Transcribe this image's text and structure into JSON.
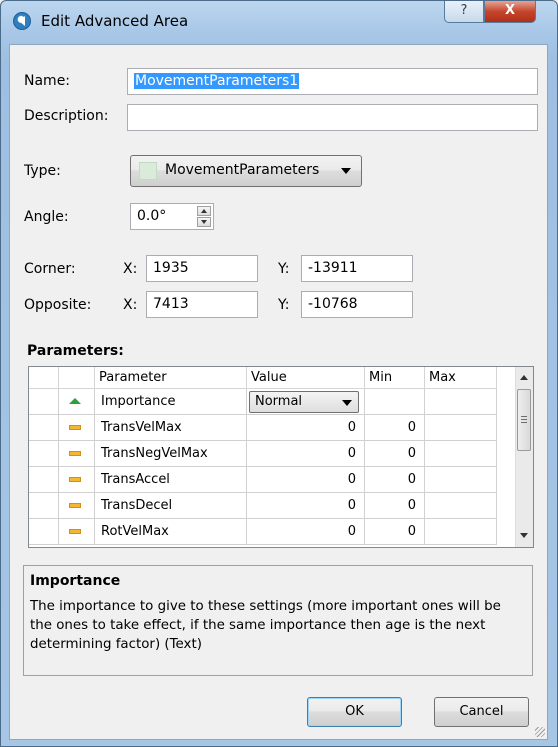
{
  "window": {
    "title": "Edit Advanced Area",
    "help_glyph": "?",
    "close_glyph": "X"
  },
  "form": {
    "name_label": "Name:",
    "name_value": "MovementParameters1",
    "description_label": "Description:",
    "description_value": "",
    "type_label": "Type:",
    "type_value": "MovementParameters",
    "angle_label": "Angle:",
    "angle_value": "0.0°",
    "corner_label": "Corner:",
    "corner_x_label": "X:",
    "corner_x": "1935",
    "corner_y_label": "Y:",
    "corner_y": "-13911",
    "opposite_label": "Opposite:",
    "opposite_x_label": "X:",
    "opposite_x": "7413",
    "opposite_y_label": "Y:",
    "opposite_y": "-10768"
  },
  "parameters": {
    "title": "Parameters:",
    "columns": [
      "Parameter",
      "Value",
      "Min",
      "Max"
    ],
    "rows": [
      {
        "icon": "green-triangle-icon",
        "name": "Importance",
        "value": "Normal",
        "min": "",
        "max": ""
      },
      {
        "icon": "orange-dash-icon",
        "name": "TransVelMax",
        "value": "0",
        "min": "0",
        "max": ""
      },
      {
        "icon": "orange-dash-icon",
        "name": "TransNegVelMax",
        "value": "0",
        "min": "0",
        "max": ""
      },
      {
        "icon": "orange-dash-icon",
        "name": "TransAccel",
        "value": "0",
        "min": "0",
        "max": ""
      },
      {
        "icon": "orange-dash-icon",
        "name": "TransDecel",
        "value": "0",
        "min": "0",
        "max": ""
      },
      {
        "icon": "orange-dash-icon",
        "name": "RotVelMax",
        "value": "0",
        "min": "0",
        "max": ""
      }
    ]
  },
  "help": {
    "title": "Importance",
    "text": "The importance to give to these settings (more important ones will be the ones to take effect, if the same importance then age is the next determining factor) (Text)"
  },
  "buttons": {
    "ok": "OK",
    "cancel": "Cancel"
  }
}
